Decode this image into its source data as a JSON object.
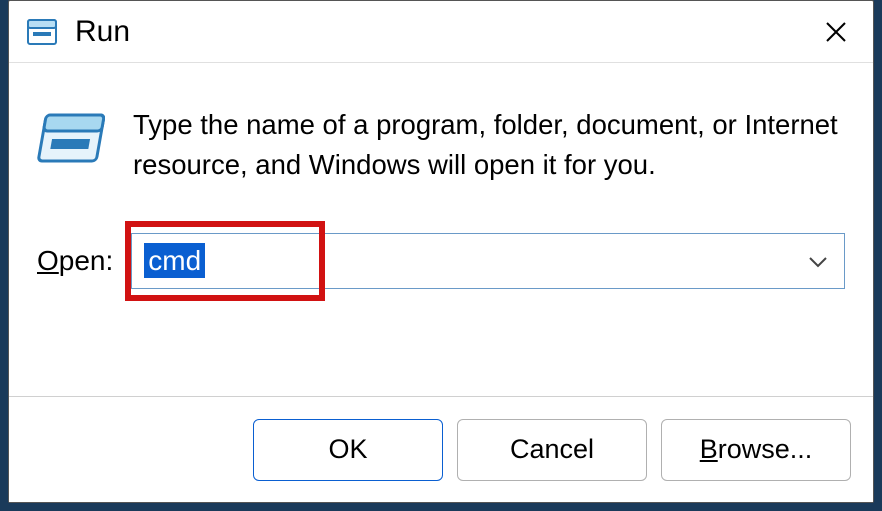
{
  "title": "Run",
  "instruction": "Type the name of a program, folder, document, or Internet resource, and Windows will open it for you.",
  "openLabel": {
    "underlined": "O",
    "rest": "pen:"
  },
  "inputValue": "cmd",
  "buttons": {
    "ok": "OK",
    "cancel": "Cancel",
    "browse": {
      "underlined": "B",
      "rest": "rowse..."
    }
  }
}
